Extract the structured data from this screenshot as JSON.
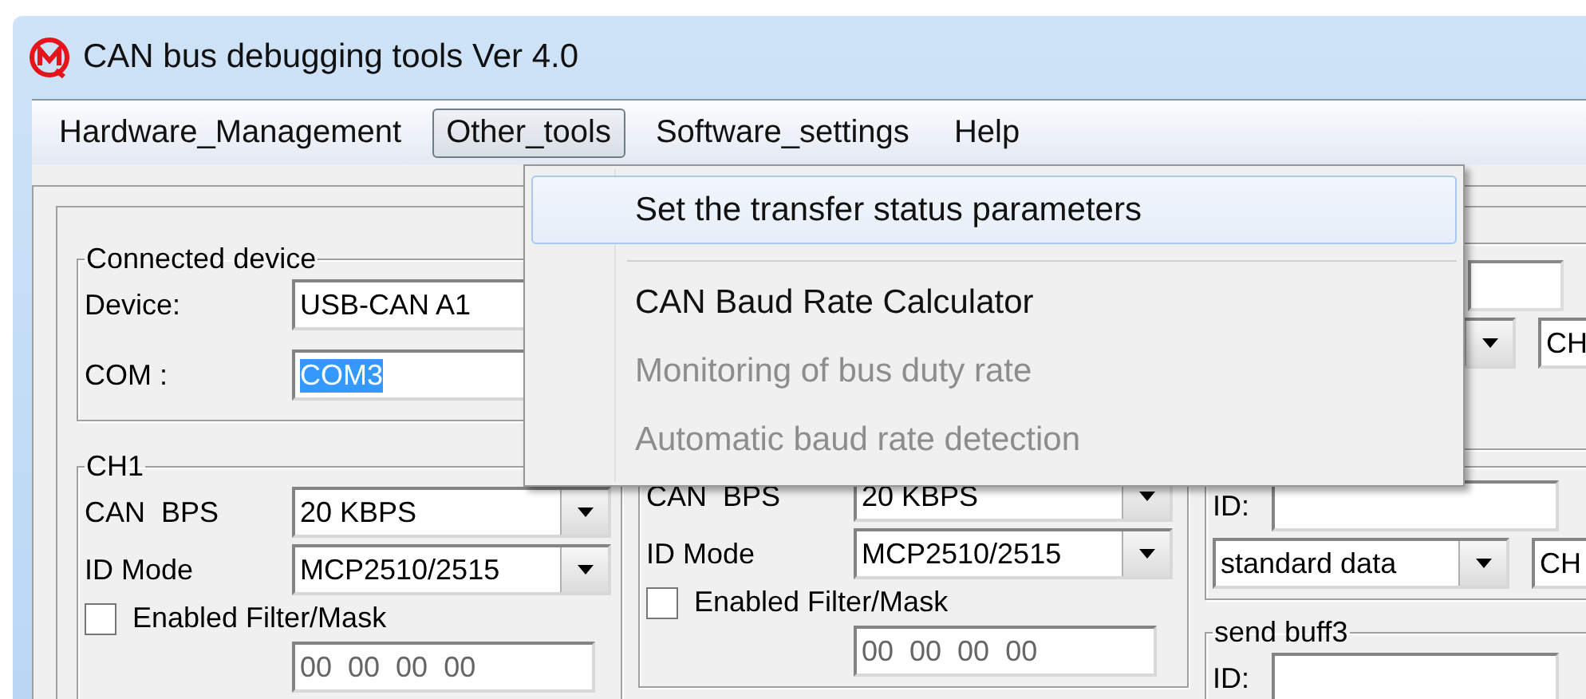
{
  "window": {
    "title": "CAN bus debugging tools Ver 4.0"
  },
  "menu_bar": [
    {
      "label": "Hardware_Management",
      "selected": false
    },
    {
      "label": "Other_tools",
      "selected": true
    },
    {
      "label": "Software_settings",
      "selected": false
    },
    {
      "label": "Help",
      "selected": false
    }
  ],
  "dropdown": {
    "items": [
      {
        "kind": "item",
        "label": "Set the transfer status parameters",
        "highlighted": true,
        "disabled": false
      },
      {
        "kind": "separator"
      },
      {
        "kind": "item",
        "label": "CAN Baud Rate Calculator",
        "highlighted": false,
        "disabled": false
      },
      {
        "kind": "item",
        "label": "Monitoring of bus duty rate",
        "highlighted": false,
        "disabled": true
      },
      {
        "kind": "item",
        "label": "Automatic baud rate detection",
        "highlighted": false,
        "disabled": true
      }
    ]
  },
  "connected_device": {
    "title": "Connected device",
    "device_label": "Device:",
    "device_value": "USB-CAN A1",
    "com_label": "COM :",
    "com_value": "COM3",
    "com_text_selected": true
  },
  "channels": [
    {
      "title": "CH1",
      "bps_label": "CAN  BPS",
      "bps_value": "20 KBPS",
      "id_mode_label": "ID Mode",
      "id_mode_value": "MCP2510/2515",
      "filter_label": "Enabled Filter/Mask",
      "filter_checked": false,
      "filter_value": "00  00  00  00"
    },
    {
      "bps_label": "CAN  BPS",
      "bps_value": "20 KBPS",
      "id_mode_label": "ID Mode",
      "id_mode_value": "MCP2510/2515",
      "filter_label": "Enabled Filter/Mask",
      "filter_checked": false,
      "filter_value": "00  00  00  00"
    }
  ],
  "right_panel": {
    "top_channel": "CH",
    "send_buff": {
      "id_label": "ID:",
      "frame_type": "standard data",
      "channel": "CH"
    },
    "send_buff3": {
      "title": "send buff3",
      "id_label": "ID:"
    }
  }
}
